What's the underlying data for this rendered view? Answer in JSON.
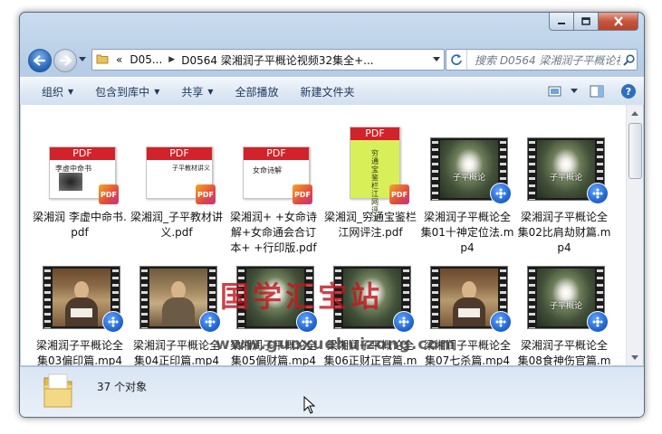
{
  "window": {
    "caption_buttons": [
      "minimize",
      "maximize",
      "close"
    ]
  },
  "address": {
    "overflow": "«",
    "crumbs": [
      "D05...",
      "D0564 梁湘润子平概论视频32集全+..."
    ]
  },
  "search": {
    "placeholder": "搜索 D0564 梁湘润子平概论视..."
  },
  "toolbar": {
    "organize": "组织",
    "include_library": "包含到库中",
    "share": "共享",
    "play_all": "全部播放",
    "new_folder": "新建文件夹"
  },
  "files": [
    {
      "name": "梁湘润 李虚中命书.pdf",
      "kind": "pdf",
      "cover": "李虚中命书"
    },
    {
      "name": "梁湘润_子平教材讲义.pdf",
      "kind": "pdf",
      "cover": "子平教材讲义"
    },
    {
      "name": "梁湘润+ +女命诗解+女命通会合订本+ +行印版.pdf",
      "kind": "pdf",
      "cover": "女命诗解"
    },
    {
      "name": "梁湘润_穷通宝鉴栏江网评注.pdf",
      "kind": "pdf",
      "cover": "穷通宝鉴 栏江网评注"
    },
    {
      "name": "梁湘润子平概论全集01十神定位法.mp4",
      "kind": "video",
      "frame": "lotus",
      "overlay": "子平概论"
    },
    {
      "name": "梁湘润子平概论全集02比肩劫财篇.mp4",
      "kind": "video",
      "frame": "lotus",
      "overlay": "子平概论"
    },
    {
      "name": "梁湘润子平概论全集03偏印篇.mp4",
      "kind": "video",
      "frame": "person"
    },
    {
      "name": "梁湘润子平概论全集04正印篇.mp4",
      "kind": "video",
      "frame": "person"
    },
    {
      "name": "梁湘润子平概论全集05偏财篇.mp4",
      "kind": "video",
      "frame": "lotus"
    },
    {
      "name": "梁湘润子平概论全集06正财正官篇.mp4",
      "kind": "video",
      "frame": "lotus"
    },
    {
      "name": "梁湘润子平概论全集07七杀篇.mp4",
      "kind": "video",
      "frame": "person"
    },
    {
      "name": "梁湘润子平概论全集08食神伤官篇.mp4",
      "kind": "video",
      "frame": "lotus",
      "overlay": "子平概论"
    }
  ],
  "labels_visible": [
    "梁湘润 李虚中命书.pdf",
    "梁湘润_子平教材讲义.pdf",
    "梁湘润+ +女命诗解+女命通会合订本+ +行印版.pdf",
    "梁湘润_穷通宝鉴栏江网评注.pdf",
    "梁湘润子平概论全集01十神定位法.mp4",
    "梁湘润子平概论全集02比肩劫财篇.mp4",
    "梁湘润子平概论全集03偏印篇.mp4",
    "梁湘润子平概论全集04正印篇.mp4",
    "梁湘润子平概论全集05偏财篇.mp4",
    "梁湘润子平概论全集06正财正官篇.mp4",
    "梁湘润子平概论全集07七杀篇.mp4",
    "梁湘润子平概论全集08食神伤官篇.mp4"
  ],
  "pdf_band_text": "PDF",
  "pdf_badge_text": "PDF",
  "watermark": {
    "text": "国学汇宝站",
    "url": "www.guoxuehuizong.com"
  },
  "details": {
    "count": "37 个对象"
  },
  "colors": {
    "pdf_red": "#d2232a",
    "watermark_red": "#c01820",
    "toolbar_text": "#1e395b"
  }
}
